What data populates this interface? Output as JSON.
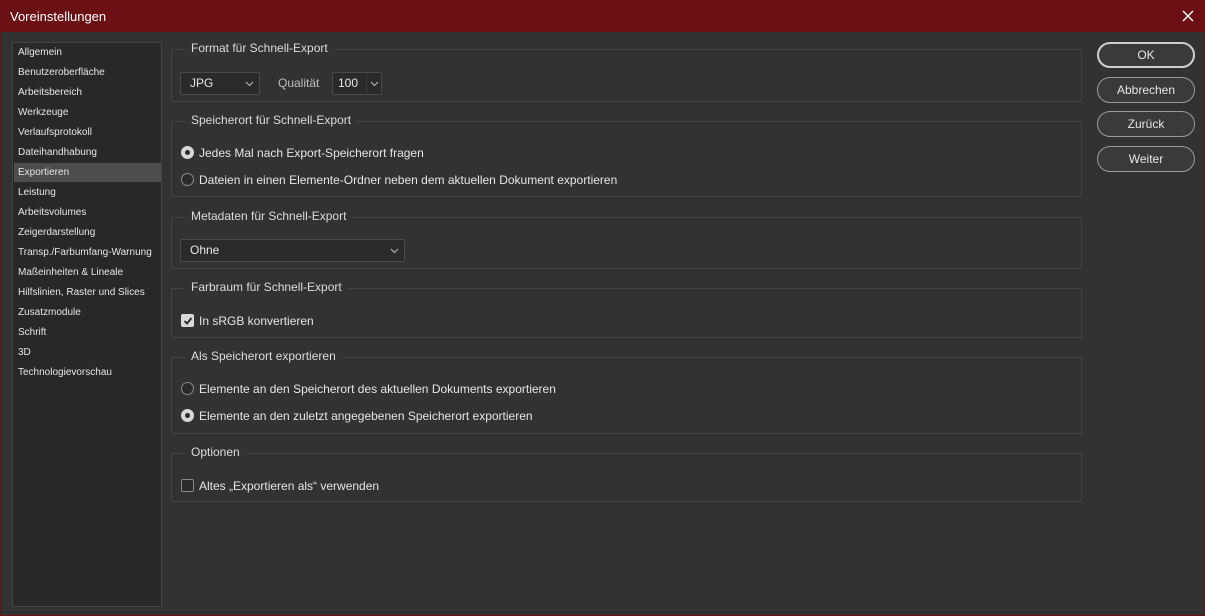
{
  "window": {
    "title": "Voreinstellungen",
    "close_icon": "close-icon"
  },
  "sidebar": {
    "items": [
      {
        "label": "Allgemein"
      },
      {
        "label": "Benutzeroberfläche"
      },
      {
        "label": "Arbeitsbereich"
      },
      {
        "label": "Werkzeuge"
      },
      {
        "label": "Verlaufsprotokoll"
      },
      {
        "label": "Dateihandhabung"
      },
      {
        "label": "Exportieren",
        "selected": true
      },
      {
        "label": "Leistung"
      },
      {
        "label": "Arbeitsvolumes"
      },
      {
        "label": "Zeigerdarstellung"
      },
      {
        "label": "Transp./Farbumfang-Warnung"
      },
      {
        "label": "Maßeinheiten & Lineale"
      },
      {
        "label": "Hilfslinien, Raster und Slices"
      },
      {
        "label": "Zusatzmodule"
      },
      {
        "label": "Schrift"
      },
      {
        "label": "3D"
      },
      {
        "label": "Technologievorschau"
      }
    ]
  },
  "format": {
    "legend": "Format für Schnell-Export",
    "format_value": "JPG",
    "quality_label": "Qualität",
    "quality_value": "100"
  },
  "location": {
    "legend": "Speicherort für Schnell-Export",
    "option_ask": "Jedes Mal nach Export-Speicherort fragen",
    "option_ask_checked": true,
    "option_folder": "Dateien in einen Elemente-Ordner neben dem aktuellen Dokument exportieren",
    "option_folder_checked": false
  },
  "metadata": {
    "legend": "Metadaten für Schnell-Export",
    "value": "Ohne"
  },
  "colorspace": {
    "legend": "Farbraum für Schnell-Export",
    "srgb_label": "In sRGB konvertieren",
    "srgb_checked": true
  },
  "export_as": {
    "legend": "Als Speicherort exportieren",
    "option_current": "Elemente an den Speicherort des aktuellen Dokuments exportieren",
    "option_current_checked": false,
    "option_last": "Elemente an den zuletzt angegebenen Speicherort exportieren",
    "option_last_checked": true
  },
  "options": {
    "legend": "Optionen",
    "legacy_label": "Altes „Exportieren als“ verwenden",
    "legacy_checked": false
  },
  "buttons": {
    "ok": "OK",
    "cancel": "Abbrechen",
    "back": "Zurück",
    "next": "Weiter"
  },
  "colors": {
    "titlebar": "#6b1116",
    "panel": "#323232",
    "selected_item": "#4d4d4d"
  }
}
